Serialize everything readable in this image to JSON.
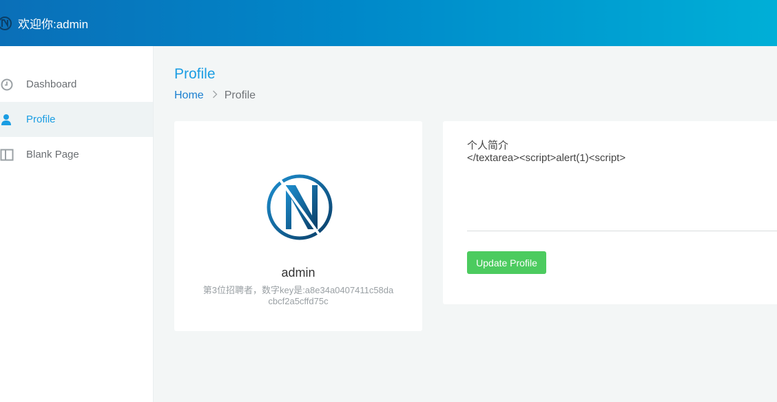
{
  "header": {
    "welcome": "欢迎你:admin"
  },
  "sidebar": {
    "items": [
      {
        "label": "Dashboard",
        "icon": "clock-icon",
        "active": false
      },
      {
        "label": "Profile",
        "icon": "user-icon",
        "active": true
      },
      {
        "label": "Blank Page",
        "icon": "columns-icon",
        "active": false
      }
    ]
  },
  "main": {
    "title": "Profile",
    "breadcrumb": {
      "home": "Home",
      "current": "Profile"
    }
  },
  "profile_card": {
    "username": "admin",
    "description": "第3位招聘者，数字key是:a8e34a0407411c58dacbcf2a5cffd75c"
  },
  "form": {
    "label": "个人简介",
    "value": "</textarea><script>alert(1)<script>",
    "submit_label": "Update Profile"
  },
  "colors": {
    "accent": "#1a9de3",
    "header_start": "#0a6fb8",
    "header_end": "#00afd7",
    "button": "#4ccb5f"
  }
}
